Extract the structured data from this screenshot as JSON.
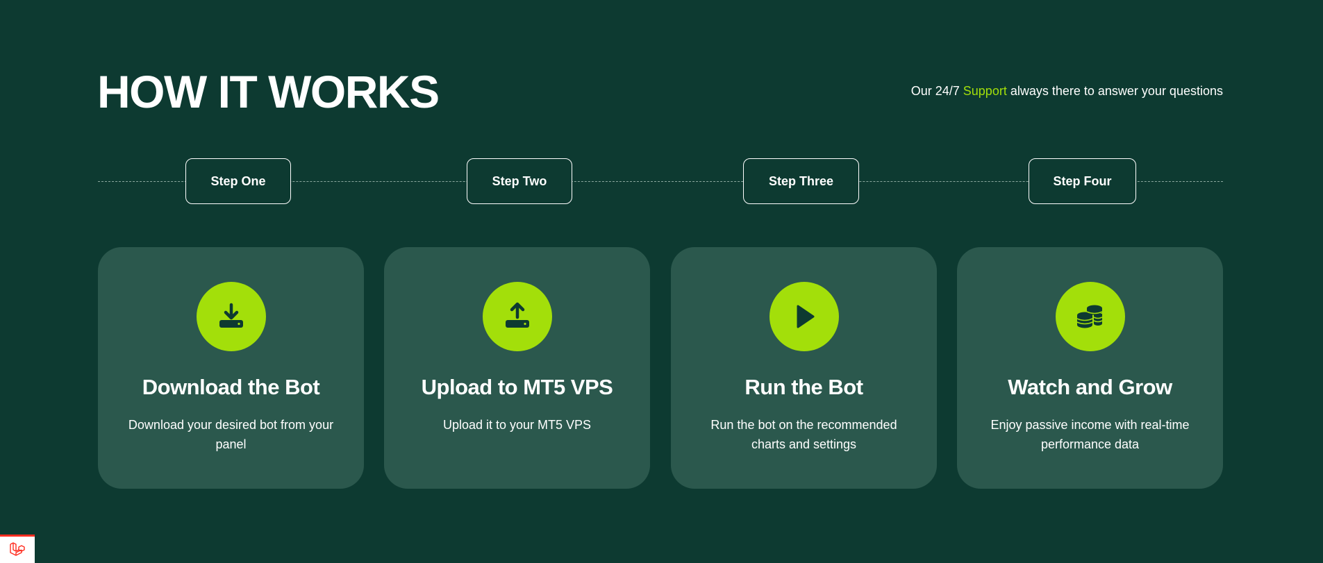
{
  "header": {
    "title": "HOW IT WORKS",
    "support_prefix": "Our 24/7 ",
    "support_link": "Support",
    "support_suffix": " always there to answer your questions"
  },
  "steps": [
    {
      "label": "Step One"
    },
    {
      "label": "Step Two"
    },
    {
      "label": "Step Three"
    },
    {
      "label": "Step Four"
    }
  ],
  "cards": [
    {
      "icon": "download-icon",
      "title": "Download the Bot",
      "description": "Download your desired bot from your panel"
    },
    {
      "icon": "upload-icon",
      "title": "Upload to MT5 VPS",
      "description": "Upload it to your MT5 VPS"
    },
    {
      "icon": "play-icon",
      "title": "Run the Bot",
      "description": "Run the bot on the recommended charts and settings"
    },
    {
      "icon": "coins-icon",
      "title": "Watch and Grow",
      "description": "Enjoy passive income with real-time performance data"
    }
  ],
  "colors": {
    "background": "#0d3a31",
    "card_background": "#2b584d",
    "accent": "#a3df0a",
    "text": "#ffffff",
    "icon_dark": "#0d3a31",
    "badge_accent": "#ff2d20"
  },
  "corner_badge": {
    "icon": "laravel-logo-icon"
  }
}
